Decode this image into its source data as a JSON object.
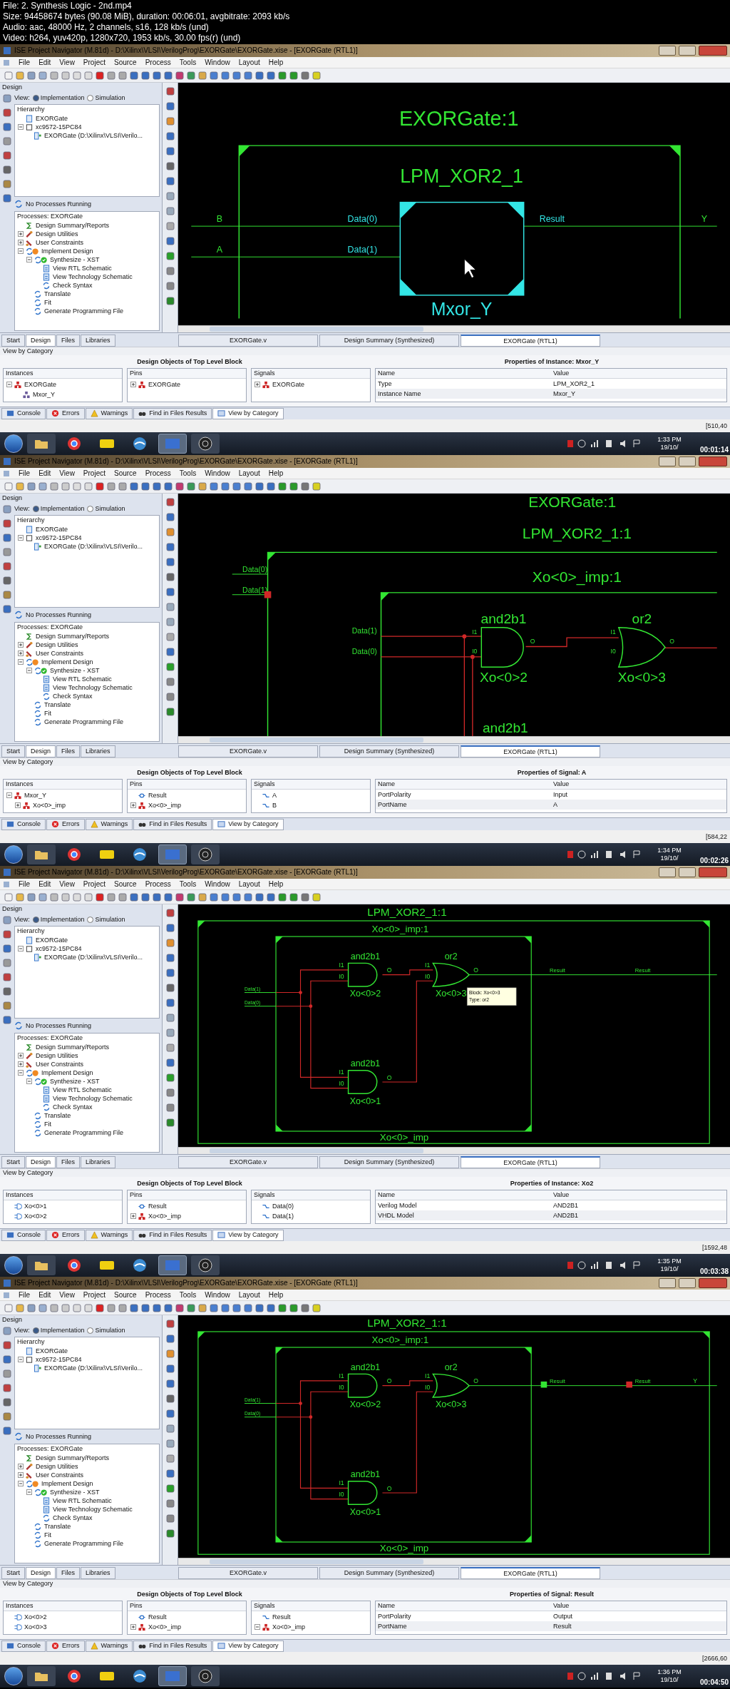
{
  "header": [
    "File: 2. Synthesis Logic - 2nd.mp4",
    "Size: 94458674 bytes (90.08 MiB), duration: 00:06:01, avgbitrate: 2093 kb/s",
    "Audio: aac, 48000 Hz, 2 channels, s16, 128 kb/s (und)",
    "Video: h264, yuv420p, 1280x720, 1953 kb/s, 30.00 fps(r) (und)"
  ],
  "frames": [
    {
      "window_title": "ISE Project Navigator (M.81d) - D:\\Xilinx\\VLSI\\VerilogProg\\EXORGate\\EXORGate.xise - [EXORGate (RTL1)]",
      "menu": [
        "File",
        "Edit",
        "View",
        "Project",
        "Source",
        "Process",
        "Tools",
        "Window",
        "Layout",
        "Help"
      ],
      "design_panel": {
        "title": "Design",
        "view_label": "View:",
        "view_options": [
          {
            "label": "Implementation",
            "selected": true
          },
          {
            "label": "Simulation",
            "selected": false
          }
        ],
        "hierarchy_title": "Hierarchy",
        "hierarchy": [
          {
            "label": "EXORGate",
            "kind": "project"
          },
          {
            "label": "xc9572-15PC84",
            "kind": "device",
            "expanded": true,
            "children": [
              {
                "label": "EXORGate (D:\\Xilinx\\VLSI\\Verilo...",
                "kind": "source"
              }
            ]
          }
        ],
        "process_status": "No Processes Running",
        "processes_title": "Processes: EXORGate",
        "processes": [
          {
            "label": "Design Summary/Reports",
            "kind": "summary"
          },
          {
            "label": "Design Utilities",
            "kind": "utility",
            "expanded": false
          },
          {
            "label": "User Constraints",
            "kind": "constraint",
            "expanded": false
          },
          {
            "label": "Implement Design",
            "kind": "warning",
            "expanded": true,
            "children": [
              {
                "label": "Synthesize - XST",
                "kind": "done",
                "expanded": true,
                "children": [
                  {
                    "label": "View RTL Schematic",
                    "kind": "view"
                  },
                  {
                    "label": "View Technology Schematic",
                    "kind": "view"
                  },
                  {
                    "label": "Check Syntax",
                    "kind": "process"
                  }
                ]
              },
              {
                "label": "Translate",
                "kind": "process"
              },
              {
                "label": "Fit",
                "kind": "process"
              },
              {
                "label": "Generate Programming File",
                "kind": "process"
              }
            ]
          }
        ]
      },
      "schematic": {
        "kind": "block",
        "title": "EXORGate:1",
        "block": "LPM_XOR2_1",
        "inputs": [
          "B",
          "A"
        ],
        "pins": [
          "Data(0)",
          "Data(1)"
        ],
        "output_pin": "Result",
        "output": "Y",
        "instance": "Mxor_Y"
      },
      "panel_tabs": [
        {
          "label": "Start",
          "selected": false
        },
        {
          "label": "Design",
          "selected": true
        },
        {
          "label": "Files",
          "selected": false
        },
        {
          "label": "Libraries",
          "selected": false
        }
      ],
      "document_tabs": [
        {
          "label": "EXORGate.v",
          "selected": false
        },
        {
          "label": "Design Summary (Synthesized)",
          "selected": false
        },
        {
          "label": "EXORGate (RTL1)",
          "selected": true
        }
      ],
      "view_by_category": "View by Category",
      "objects_title": "Design Objects of Top Level Block",
      "instances": {
        "header": "Instances",
        "items": [
          {
            "label": "EXORGate",
            "kind": "block",
            "expanded": true,
            "children": [
              {
                "label": "Mxor_Y",
                "kind": "instance"
              }
            ]
          }
        ]
      },
      "pins": {
        "header": "Pins",
        "items": [
          {
            "label": "EXORGate",
            "kind": "block",
            "expanded": false
          }
        ]
      },
      "signals": {
        "header": "Signals",
        "items": [
          {
            "label": "EXORGate",
            "kind": "block",
            "expanded": false
          }
        ]
      },
      "properties": {
        "title": "Properties of Instance: Mxor_Y",
        "columns": [
          "Name",
          "Value"
        ],
        "rows": [
          [
            "Type",
            "LPM_XOR2_1"
          ],
          [
            "Instance Name",
            "Mxor_Y"
          ]
        ]
      },
      "console_tabs": [
        {
          "label": "Console",
          "kind": "console",
          "selected": false
        },
        {
          "label": "Errors",
          "kind": "errors",
          "selected": false
        },
        {
          "label": "Warnings",
          "kind": "warnings",
          "selected": false
        },
        {
          "label": "Find in Files Results",
          "kind": "find",
          "selected": false
        },
        {
          "label": "View by Category",
          "kind": "view",
          "selected": true
        }
      ],
      "coordinates": "[510,40",
      "taskbar": {
        "time": "1:33 PM",
        "date": "19/10/"
      },
      "timestamp": "00:01:14"
    },
    {
      "window_title": "ISE Project Navigator (M.81d) - D:\\Xilinx\\VLSI\\VerilogProg\\EXORGate\\EXORGate.xise - [EXORGate (RTL1)]",
      "menu": [
        "File",
        "Edit",
        "View",
        "Project",
        "Source",
        "Process",
        "Tools",
        "Window",
        "Layout",
        "Help"
      ],
      "design_panel": {
        "title": "Design",
        "view_label": "View:",
        "view_options": [
          {
            "label": "Implementation",
            "selected": true
          },
          {
            "label": "Simulation",
            "selected": false
          }
        ],
        "hierarchy_title": "Hierarchy",
        "hierarchy": [
          {
            "label": "EXORGate",
            "kind": "project"
          },
          {
            "label": "xc9572-15PC84",
            "kind": "device",
            "expanded": true,
            "children": [
              {
                "label": "EXORGate (D:\\Xilinx\\VLSI\\Verilo...",
                "kind": "source"
              }
            ]
          }
        ],
        "process_status": "No Processes Running",
        "processes_title": "Processes: EXORGate",
        "processes": [
          {
            "label": "Design Summary/Reports",
            "kind": "summary"
          },
          {
            "label": "Design Utilities",
            "kind": "utility",
            "expanded": false
          },
          {
            "label": "User Constraints",
            "kind": "constraint",
            "expanded": false
          },
          {
            "label": "Implement Design",
            "kind": "warning",
            "expanded": true,
            "children": [
              {
                "label": "Synthesize - XST",
                "kind": "done",
                "expanded": true,
                "children": [
                  {
                    "label": "View RTL Schematic",
                    "kind": "view"
                  },
                  {
                    "label": "View Technology Schematic",
                    "kind": "view"
                  },
                  {
                    "label": "Check Syntax",
                    "kind": "process"
                  }
                ]
              },
              {
                "label": "Translate",
                "kind": "process"
              },
              {
                "label": "Fit",
                "kind": "process"
              },
              {
                "label": "Generate Programming File",
                "kind": "process"
              }
            ]
          }
        ]
      },
      "schematic": {
        "kind": "zoomed",
        "title": "EXORGate:1",
        "block": "LPM_XOR2_1:1",
        "sub_block": "Xo<0>_imp:1",
        "outer_pins": [
          "Data(0)",
          "Data(1)"
        ],
        "inner_pins": [
          "Data(1)",
          "Data(0)"
        ],
        "gates": [
          {
            "type": "and2b1",
            "name": "Xo<0>2",
            "pins": [
              "I1",
              "I0",
              "O"
            ]
          },
          {
            "type": "or2",
            "name": "Xo<0>3",
            "pins": [
              "I1",
              "I0",
              "O"
            ]
          }
        ],
        "cut_gate": "and2b1"
      },
      "panel_tabs": [
        {
          "label": "Start",
          "selected": false
        },
        {
          "label": "Design",
          "selected": true
        },
        {
          "label": "Files",
          "selected": false
        },
        {
          "label": "Libraries",
          "selected": false
        }
      ],
      "document_tabs": [
        {
          "label": "EXORGate.v",
          "selected": false
        },
        {
          "label": "Design Summary (Synthesized)",
          "selected": false
        },
        {
          "label": "EXORGate (RTL1)",
          "selected": true
        }
      ],
      "view_by_category": "View by Category",
      "objects_title": "Design Objects of Top Level Block",
      "instances": {
        "header": "Instances",
        "items": [
          {
            "label": "Mxor_Y",
            "kind": "block",
            "expanded": true,
            "children": [
              {
                "label": "Xo<0>_imp",
                "kind": "block",
                "expanded": false
              }
            ]
          }
        ]
      },
      "pins": {
        "header": "Pins",
        "items": [
          {
            "label": "Result",
            "kind": "port"
          },
          {
            "label": "Xo<0>_imp",
            "kind": "block",
            "expanded": false
          }
        ]
      },
      "signals": {
        "header": "Signals",
        "items": [
          {
            "label": "A",
            "kind": "net"
          },
          {
            "label": "B",
            "kind": "net"
          }
        ]
      },
      "properties": {
        "title": "Properties of Signal: A",
        "columns": [
          "Name",
          "Value"
        ],
        "rows": [
          [
            "PortPolarity",
            "Input"
          ],
          [
            "PortName",
            "A"
          ]
        ]
      },
      "console_tabs": [
        {
          "label": "Console",
          "kind": "console",
          "selected": false
        },
        {
          "label": "Errors",
          "kind": "errors",
          "selected": false
        },
        {
          "label": "Warnings",
          "kind": "warnings",
          "selected": false
        },
        {
          "label": "Find in Files Results",
          "kind": "find",
          "selected": false
        },
        {
          "label": "View by Category",
          "kind": "view",
          "selected": true
        }
      ],
      "coordinates": "[584,22",
      "taskbar": {
        "time": "1:34 PM",
        "date": "19/10/"
      },
      "timestamp": "00:02:26"
    },
    {
      "window_title": "ISE Project Navigator (M.81d) - D:\\Xilinx\\VLSI\\VerilogProg\\EXORGate\\EXORGate.xise - [EXORGate (RTL1)]",
      "menu": [
        "File",
        "Edit",
        "View",
        "Project",
        "Source",
        "Process",
        "Tools",
        "Window",
        "Layout",
        "Help"
      ],
      "design_panel": {
        "title": "Design",
        "view_label": "View:",
        "view_options": [
          {
            "label": "Implementation",
            "selected": true
          },
          {
            "label": "Simulation",
            "selected": false
          }
        ],
        "hierarchy_title": "Hierarchy",
        "hierarchy": [
          {
            "label": "EXORGate",
            "kind": "project"
          },
          {
            "label": "xc9572-15PC84",
            "kind": "device",
            "expanded": true,
            "children": [
              {
                "label": "EXORGate (D:\\Xilinx\\VLSI\\Verilo...",
                "kind": "source"
              }
            ]
          }
        ],
        "process_status": "No Processes Running",
        "processes_title": "Processes: EXORGate",
        "processes": [
          {
            "label": "Design Summary/Reports",
            "kind": "summary"
          },
          {
            "label": "Design Utilities",
            "kind": "utility",
            "expanded": false
          },
          {
            "label": "User Constraints",
            "kind": "constraint",
            "expanded": false
          },
          {
            "label": "Implement Design",
            "kind": "warning",
            "expanded": true,
            "children": [
              {
                "label": "Synthesize - XST",
                "kind": "done",
                "expanded": true,
                "children": [
                  {
                    "label": "View RTL Schematic",
                    "kind": "view"
                  },
                  {
                    "label": "View Technology Schematic",
                    "kind": "view"
                  },
                  {
                    "label": "Check Syntax",
                    "kind": "process"
                  }
                ]
              },
              {
                "label": "Translate",
                "kind": "process"
              },
              {
                "label": "Fit",
                "kind": "process"
              },
              {
                "label": "Generate Programming File",
                "kind": "process"
              }
            ]
          }
        ]
      },
      "schematic": {
        "kind": "full",
        "block": "LPM_XOR2_1:1",
        "sub_block": "Xo<0>_imp:1",
        "pins": [
          "Data(1)",
          "Data(0)"
        ],
        "gates": [
          {
            "type": "and2b1",
            "name": "Xo<0>2",
            "pins": [
              "I1",
              "I0",
              "O"
            ]
          },
          {
            "type": "or2",
            "name": "Xo<0>3",
            "pins": [
              "I1",
              "I0",
              "O"
            ]
          },
          {
            "type": "and2b1",
            "name": "Xo<0>1",
            "pins": [
              "I1",
              "I0",
              "O"
            ]
          }
        ],
        "sub_name": "Xo<0>_imp",
        "outputs": [
          "Result",
          "Result"
        ],
        "tooltip": [
          "Block: Xo<0>3",
          "Type: or2"
        ]
      },
      "panel_tabs": [
        {
          "label": "Start",
          "selected": false
        },
        {
          "label": "Design",
          "selected": true
        },
        {
          "label": "Files",
          "selected": false
        },
        {
          "label": "Libraries",
          "selected": false
        }
      ],
      "document_tabs": [
        {
          "label": "EXORGate.v",
          "selected": false
        },
        {
          "label": "Design Summary (Synthesized)",
          "selected": false
        },
        {
          "label": "EXORGate (RTL1)",
          "selected": true
        }
      ],
      "view_by_category": "View by Category",
      "objects_title": "Design Objects of Top Level Block",
      "instances": {
        "header": "Instances",
        "items": [
          {
            "label": "Xo<0>1",
            "kind": "gate"
          },
          {
            "label": "Xo<0>2",
            "kind": "gate"
          }
        ]
      },
      "pins": {
        "header": "Pins",
        "items": [
          {
            "label": "Result",
            "kind": "port"
          },
          {
            "label": "Xo<0>_imp",
            "kind": "block",
            "expanded": false
          }
        ]
      },
      "signals": {
        "header": "Signals",
        "items": [
          {
            "label": "Data(0)",
            "kind": "net"
          },
          {
            "label": "Data(1)",
            "kind": "net"
          }
        ]
      },
      "properties": {
        "title": "Properties of Instance: Xo2",
        "columns": [
          "Name",
          "Value"
        ],
        "rows": [
          [
            "Verilog Model",
            "AND2B1"
          ],
          [
            "VHDL Model",
            "AND2B1"
          ]
        ]
      },
      "console_tabs": [
        {
          "label": "Console",
          "kind": "console",
          "selected": false
        },
        {
          "label": "Errors",
          "kind": "errors",
          "selected": false
        },
        {
          "label": "Warnings",
          "kind": "warnings",
          "selected": false
        },
        {
          "label": "Find in Files Results",
          "kind": "find",
          "selected": false
        },
        {
          "label": "View by Category",
          "kind": "view",
          "selected": true
        }
      ],
      "coordinates": "[1592,48",
      "taskbar": {
        "time": "1:35 PM",
        "date": "19/10/"
      },
      "timestamp": "00:03:38"
    },
    {
      "window_title": "ISE Project Navigator (M.81d) - D:\\Xilinx\\VLSI\\VerilogProg\\EXORGate\\EXORGate.xise - [EXORGate (RTL1)]",
      "menu": [
        "File",
        "Edit",
        "View",
        "Project",
        "Source",
        "Process",
        "Tools",
        "Window",
        "Layout",
        "Help"
      ],
      "design_panel": {
        "title": "Design",
        "view_label": "View:",
        "view_options": [
          {
            "label": "Implementation",
            "selected": true
          },
          {
            "label": "Simulation",
            "selected": false
          }
        ],
        "hierarchy_title": "Hierarchy",
        "hierarchy": [
          {
            "label": "EXORGate",
            "kind": "project"
          },
          {
            "label": "xc9572-15PC84",
            "kind": "device",
            "expanded": true,
            "children": [
              {
                "label": "EXORGate (D:\\Xilinx\\VLSI\\Verilo...",
                "kind": "source"
              }
            ]
          }
        ],
        "process_status": "No Processes Running",
        "processes_title": "Processes: EXORGate",
        "processes": [
          {
            "label": "Design Summary/Reports",
            "kind": "summary"
          },
          {
            "label": "Design Utilities",
            "kind": "utility",
            "expanded": false
          },
          {
            "label": "User Constraints",
            "kind": "constraint",
            "expanded": false
          },
          {
            "label": "Implement Design",
            "kind": "warning",
            "expanded": true,
            "children": [
              {
                "label": "Synthesize - XST",
                "kind": "done",
                "expanded": true,
                "children": [
                  {
                    "label": "View RTL Schematic",
                    "kind": "view"
                  },
                  {
                    "label": "View Technology Schematic",
                    "kind": "view"
                  },
                  {
                    "label": "Check Syntax",
                    "kind": "process"
                  }
                ]
              },
              {
                "label": "Translate",
                "kind": "process"
              },
              {
                "label": "Fit",
                "kind": "process"
              },
              {
                "label": "Generate Programming File",
                "kind": "process"
              }
            ]
          }
        ]
      },
      "schematic": {
        "kind": "full",
        "block": "LPM_XOR2_1:1",
        "sub_block": "Xo<0>_imp:1",
        "pins": [
          "Data(1)",
          "Data(0)"
        ],
        "gates": [
          {
            "type": "and2b1",
            "name": "Xo<0>2",
            "pins": [
              "I1",
              "I0",
              "O"
            ]
          },
          {
            "type": "or2",
            "name": "Xo<0>3",
            "pins": [
              "I1",
              "I0",
              "O"
            ]
          },
          {
            "type": "and2b1",
            "name": "Xo<0>1",
            "pins": [
              "I1",
              "I0",
              "O"
            ]
          }
        ],
        "sub_name": "Xo<0>_imp",
        "outputs": [
          "Result",
          "Result"
        ],
        "output_markers": true,
        "port": "Y"
      },
      "panel_tabs": [
        {
          "label": "Start",
          "selected": false
        },
        {
          "label": "Design",
          "selected": true
        },
        {
          "label": "Files",
          "selected": false
        },
        {
          "label": "Libraries",
          "selected": false
        }
      ],
      "document_tabs": [
        {
          "label": "EXORGate.v",
          "selected": false
        },
        {
          "label": "Design Summary (Synthesized)",
          "selected": false
        },
        {
          "label": "EXORGate (RTL1)",
          "selected": true
        }
      ],
      "view_by_category": "View by Category",
      "objects_title": "Design Objects of Top Level Block",
      "instances": {
        "header": "Instances",
        "items": [
          {
            "label": "Xo<0>2",
            "kind": "gate"
          },
          {
            "label": "Xo<0>3",
            "kind": "gate"
          }
        ]
      },
      "pins": {
        "header": "Pins",
        "items": [
          {
            "label": "Result",
            "kind": "port"
          },
          {
            "label": "Xo<0>_imp",
            "kind": "block",
            "expanded": false
          }
        ]
      },
      "signals": {
        "header": "Signals",
        "items": [
          {
            "label": "Result",
            "kind": "net"
          },
          {
            "label": "Xo<0>_imp",
            "kind": "block",
            "expanded": true
          }
        ]
      },
      "properties": {
        "title": "Properties of Signal: Result",
        "columns": [
          "Name",
          "Value"
        ],
        "rows": [
          [
            "PortPolarity",
            "Output"
          ],
          [
            "PortName",
            "Result"
          ]
        ]
      },
      "console_tabs": [
        {
          "label": "Console",
          "kind": "console",
          "selected": false
        },
        {
          "label": "Errors",
          "kind": "errors",
          "selected": false
        },
        {
          "label": "Warnings",
          "kind": "warnings",
          "selected": false
        },
        {
          "label": "Find in Files Results",
          "kind": "find",
          "selected": false
        },
        {
          "label": "View by Category",
          "kind": "view",
          "selected": true
        }
      ],
      "coordinates": "[2666,60",
      "taskbar": {
        "time": "1:36 PM",
        "date": "19/10/"
      },
      "timestamp": "00:04:50"
    }
  ]
}
